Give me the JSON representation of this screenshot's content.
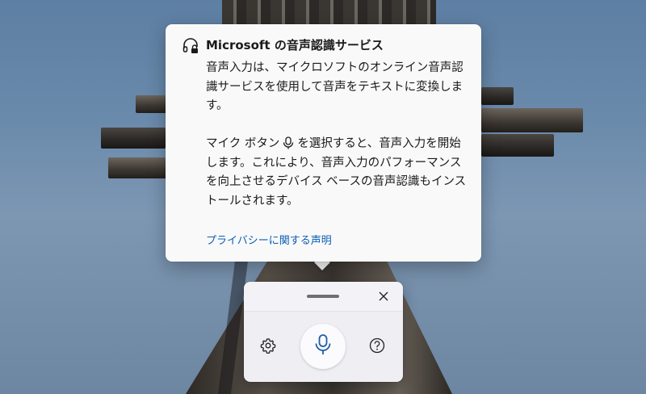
{
  "flyout": {
    "title": "Microsoft の音声認識サービス",
    "paragraph1": "音声入力は、マイクロソフトのオンライン音声認識サービスを使用して音声をテキストに変換します。",
    "paragraph2_before_icon": "マイク ボタン",
    "paragraph2_after_icon": "を選択すると、音声入力を開始します。これにより、音声入力のパフォーマンスを向上させるデバイス ベースの音声認識もインストールされます。",
    "privacy_link": "プライバシーに関する声明",
    "header_icon": "headset-lock-icon",
    "inline_icon": "microphone-icon"
  },
  "voice_panel": {
    "drag_handle": "drag-handle",
    "close_icon": "close-icon",
    "settings_icon": "gear-icon",
    "mic_icon": "microphone-icon",
    "help_icon": "help-icon",
    "accent_color": "#1f5fa8"
  }
}
